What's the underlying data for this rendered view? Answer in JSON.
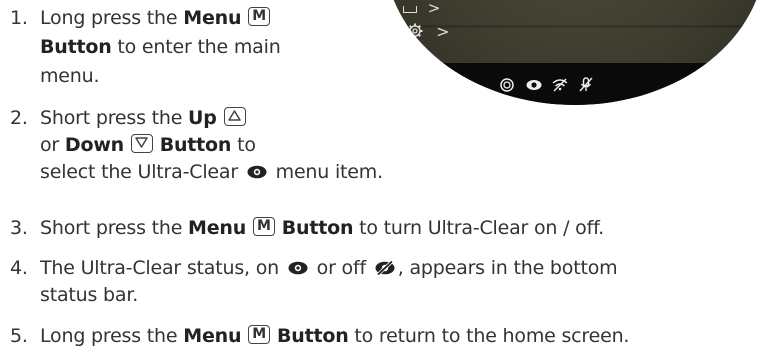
{
  "steps": [
    {
      "number": "1.",
      "lines": [
        {
          "a": "Long press the ",
          "b": "Menu"
        },
        {
          "b": "Button",
          "a": " to enter the main"
        },
        {
          "a": "menu."
        }
      ]
    },
    {
      "number": "2.",
      "lines": [
        {
          "a": "Short press the ",
          "b": "Up"
        },
        {
          "a": "or ",
          "b": "Down",
          "c": "Button",
          "d": " to"
        },
        {
          "a": "select the Ultra-Clear",
          "b": " menu item."
        }
      ]
    },
    {
      "number": "3.",
      "lines": [
        {
          "a": "Short press the ",
          "b": "Menu",
          "c": "Button",
          "d": " to turn Ultra-Clear on / off."
        }
      ]
    },
    {
      "number": "4.",
      "lines": [
        {
          "a": "The Ultra-Clear status, on",
          "b": " or off",
          "c": ", appears in the bottom"
        },
        {
          "a": "status bar."
        }
      ]
    },
    {
      "number": "5.",
      "lines": [
        {
          "a": "Long press the ",
          "b": "Menu",
          "c": "Button",
          "d": " to return to the home screen."
        }
      ]
    }
  ],
  "keys": {
    "menu": "M"
  },
  "device": {
    "menu_items": [
      {
        "icon": "display-icon",
        "arrow": ">"
      },
      {
        "icon": "gear-icon",
        "arrow": ">"
      }
    ],
    "status_icons": [
      "compass-icon",
      "eye-icon",
      "wifi-off-icon",
      "mic-off-icon"
    ]
  },
  "colors": {
    "text": "#333333",
    "screen": "#3e3d2f",
    "statusbar": "#0a0a0a"
  }
}
